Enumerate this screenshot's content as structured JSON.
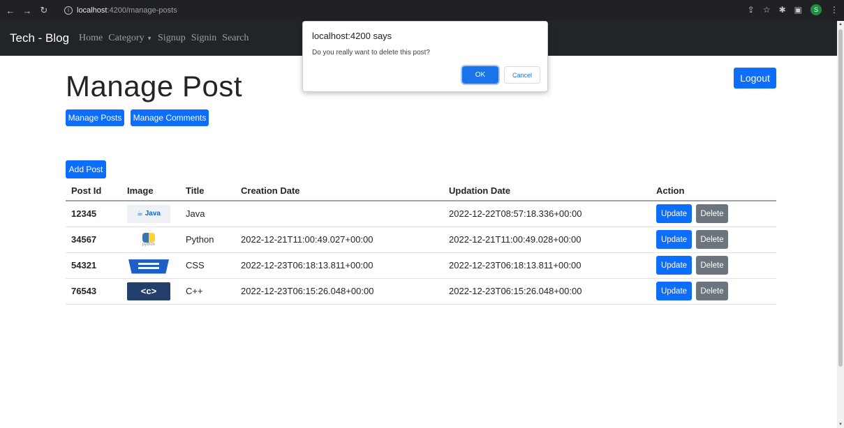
{
  "browser": {
    "url_host": "localhost",
    "url_path": ":4200/manage-posts",
    "profile_initial": "S"
  },
  "navbar": {
    "brand": "Tech - Blog",
    "links": [
      "Home",
      "Category",
      "Signup",
      "Signin",
      "Search"
    ]
  },
  "page": {
    "title": "Manage Post",
    "manage_posts_label": "Manage Posts",
    "manage_comments_label": "Manage Comments",
    "logout_label": "Logout",
    "add_post_label": "Add Post"
  },
  "table": {
    "headers": [
      "Post Id",
      "Image",
      "Title",
      "Creation Date",
      "Updation Date",
      "Action"
    ],
    "rows": [
      {
        "id": "12345",
        "image_label": "Java",
        "title": "Java",
        "creation_date": "",
        "updation_date": "2022-12-22T08:57:18.336+00:00"
      },
      {
        "id": "34567",
        "image_label": "python",
        "title": "Python",
        "creation_date": "2022-12-21T11:00:49.027+00:00",
        "updation_date": "2022-12-21T11:00:49.028+00:00"
      },
      {
        "id": "54321",
        "image_label": "",
        "title": "CSS",
        "creation_date": "2022-12-23T06:18:13.811+00:00",
        "updation_date": "2022-12-23T06:18:13.811+00:00"
      },
      {
        "id": "76543",
        "image_label": "<c>",
        "title": "C++",
        "creation_date": "2022-12-23T06:15:26.048+00:00",
        "updation_date": "2022-12-23T06:15:26.048+00:00"
      }
    ],
    "update_label": "Update",
    "delete_label": "Delete"
  },
  "dialog": {
    "title": "localhost:4200 says",
    "message": "Do you really want to delete this post?",
    "ok_label": "OK",
    "cancel_label": "Cancel"
  },
  "colors": {
    "primary": "#0d6efd",
    "secondary": "#6c757d",
    "navbar": "#212529",
    "dialog_ok": "#1a73e8"
  }
}
